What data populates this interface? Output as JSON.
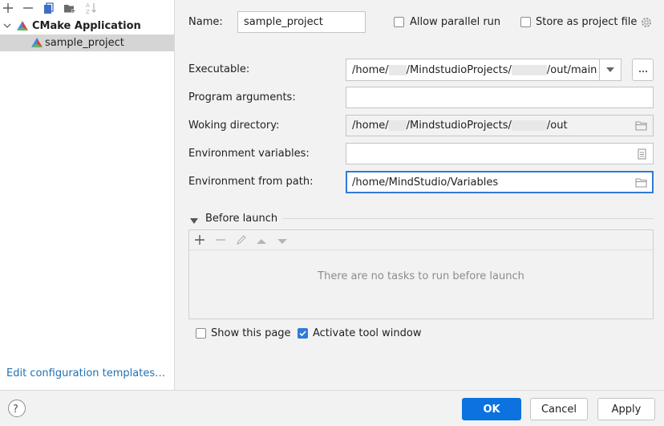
{
  "colors": {
    "accent": "#2f7bd6",
    "primary_button": "#0b72e0",
    "link": "#2470b3",
    "selection": "#d5d5d5"
  },
  "left_panel": {
    "toolbar": {
      "icons": [
        "add-icon",
        "remove-icon",
        "copy-icon",
        "folder-add-icon",
        "sort-alpha-icon"
      ]
    },
    "tree": {
      "group_label": "CMake Application",
      "item_label": "sample_project"
    },
    "edit_templates_link": "Edit configuration templates…"
  },
  "form": {
    "name_label": "Name:",
    "name_value": "sample_project",
    "allow_parallel_label": "Allow parallel run",
    "store_project_label": "Store as project file",
    "executable": {
      "label": "Executable:",
      "prefix": "/home/",
      "mid": "/MindstudioProjects/",
      "suffix": "/out/main"
    },
    "program_args": {
      "label": "Program arguments:",
      "value": ""
    },
    "working_dir": {
      "label": "Woking directory:",
      "prefix": "/home/",
      "mid": "/MindstudioProjects/",
      "suffix": "/out"
    },
    "env_vars": {
      "label": "Environment variables:",
      "value": ""
    },
    "env_from_path": {
      "label": "Environment from path:",
      "value": "/home/MindStudio/Variables"
    }
  },
  "before_launch": {
    "title": "Before launch",
    "empty_text": "There are no tasks to run before launch"
  },
  "options": {
    "show_page_label": "Show this page",
    "show_page_checked": false,
    "activate_tool_label": "Activate tool window",
    "activate_tool_checked": true
  },
  "footer": {
    "ok": "OK",
    "cancel": "Cancel",
    "apply": "Apply"
  }
}
